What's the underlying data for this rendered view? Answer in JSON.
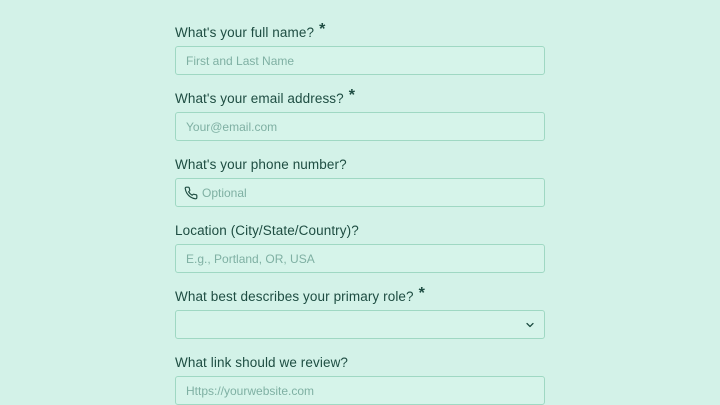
{
  "form": {
    "fields": [
      {
        "label": "What's your full name?",
        "required": "*",
        "placeholder": "First and Last Name",
        "value": ""
      },
      {
        "label": "What's your email address?",
        "required": "*",
        "placeholder": "Your@email.com",
        "value": ""
      },
      {
        "label": "What's your phone number?",
        "placeholder": "Optional",
        "value": "",
        "icon": "phone-icon"
      },
      {
        "label": "Location (City/State/Country)?",
        "placeholder": "E.g., Portland, OR, USA",
        "value": ""
      },
      {
        "label": "What best describes your primary role?",
        "required": "*",
        "selected": "",
        "icon": "chevron-down-icon"
      },
      {
        "label": "What link should we review?",
        "placeholder": "Https://yourwebsite.com",
        "value": ""
      }
    ]
  },
  "colors": {
    "background": "#d3f2e8",
    "label": "#1e4d42",
    "border": "#9fd8c3",
    "placeholder": "#7fb0a3"
  }
}
